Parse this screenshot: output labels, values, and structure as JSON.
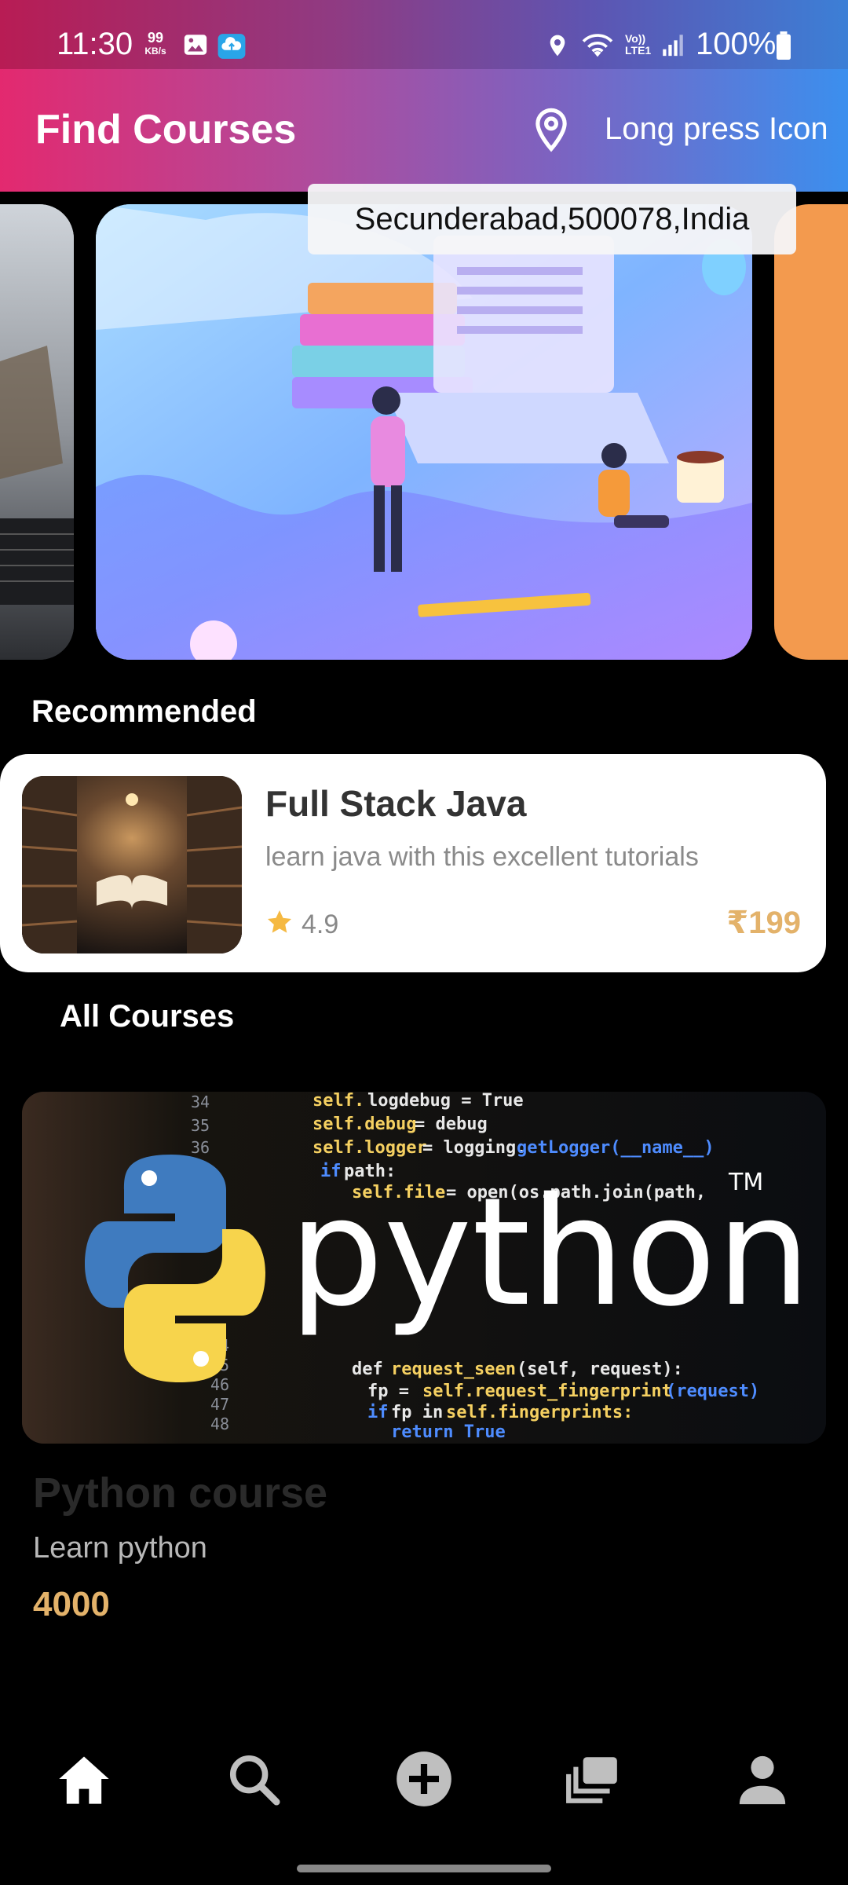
{
  "status_bar": {
    "time": "11:30",
    "speed_value": "99",
    "speed_unit": "KB/s",
    "battery_percent": "100%"
  },
  "app_bar": {
    "title": "Find Courses",
    "location_hint": "Long press Icon"
  },
  "tooltip": {
    "text": "Secunderabad,500078,India"
  },
  "sections": {
    "recommended": "Recommended",
    "all_courses": "All Courses"
  },
  "recommended_course": {
    "title": "Full Stack Java",
    "description": "learn java with this excellent tutorials",
    "rating": "4.9",
    "price": "₹199"
  },
  "all_courses": [
    {
      "banner_text": "python",
      "banner_tm": "TM",
      "title": "Python  course",
      "subtitle": "Learn python",
      "price": "4000"
    }
  ],
  "bottom_nav": [
    {
      "icon": "home-icon",
      "active": true
    },
    {
      "icon": "search-icon",
      "active": false
    },
    {
      "icon": "add-circle-icon",
      "active": false
    },
    {
      "icon": "library-icon",
      "active": false
    },
    {
      "icon": "person-icon",
      "active": false
    }
  ],
  "colors": {
    "price": "#e3b26a",
    "star": "#f5b942",
    "header_start": "#e3296f",
    "header_end": "#3b8fee"
  }
}
